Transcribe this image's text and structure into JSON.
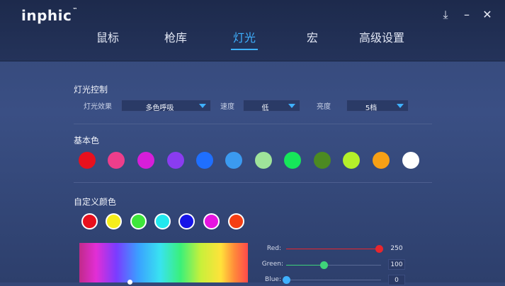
{
  "app": {
    "logo": "inphic",
    "logo_mark": "™"
  },
  "window_controls": {
    "download_icon": "⤓",
    "minimize_icon": "–",
    "close_icon": "✕"
  },
  "tabs": [
    {
      "label": "鼠标"
    },
    {
      "label": "枪库"
    },
    {
      "label": "灯光"
    },
    {
      "label": "宏"
    },
    {
      "label": "高级设置"
    }
  ],
  "active_tab": "灯光",
  "lighting_control": {
    "title": "灯光控制",
    "effect_label": "灯光效果",
    "effect_value": "多色呼吸",
    "speed_label": "速度",
    "speed_value": "低",
    "brightness_label": "亮度",
    "brightness_value": "5档"
  },
  "basic_colors": {
    "title": "基本色",
    "colors": [
      "#e8101d",
      "#ee3e8b",
      "#d61ed9",
      "#8a3cf0",
      "#1f6fff",
      "#3b9af0",
      "#9fe39a",
      "#16e65a",
      "#4c8a22",
      "#b4f02a",
      "#f7a015",
      "#ffffff"
    ]
  },
  "custom_colors": {
    "title": "自定义颜色",
    "colors": [
      "#e8101d",
      "#f6ee1a",
      "#3ee63a",
      "#22e8ee",
      "#1614e8",
      "#e614e0",
      "#f53e13"
    ]
  },
  "rgb": {
    "red_label": "Red:",
    "red_value": 250,
    "red_color": "#e8262d",
    "green_label": "Green:",
    "green_value": 100,
    "green_color": "#3fd37a",
    "blue_label": "Blue:",
    "blue_value": 0,
    "blue_color": "#3fb1ff",
    "max_value": 255
  }
}
